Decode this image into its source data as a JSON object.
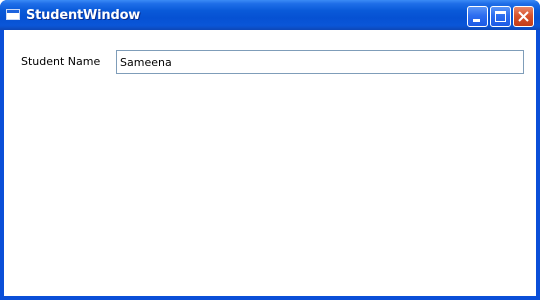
{
  "window": {
    "title": "StudentWindow",
    "icon": "window-app-icon",
    "controls": {
      "minimize": "minimize-icon",
      "maximize": "maximize-icon",
      "close": "close-icon"
    }
  },
  "form": {
    "student_name_label": "Student Name",
    "student_name_value": "Sameena"
  },
  "colors": {
    "titlebar": "#0a5ad9",
    "frame": "#0a4fd8",
    "close_button": "#d8532d",
    "textbox_border": "#7f9db9"
  }
}
